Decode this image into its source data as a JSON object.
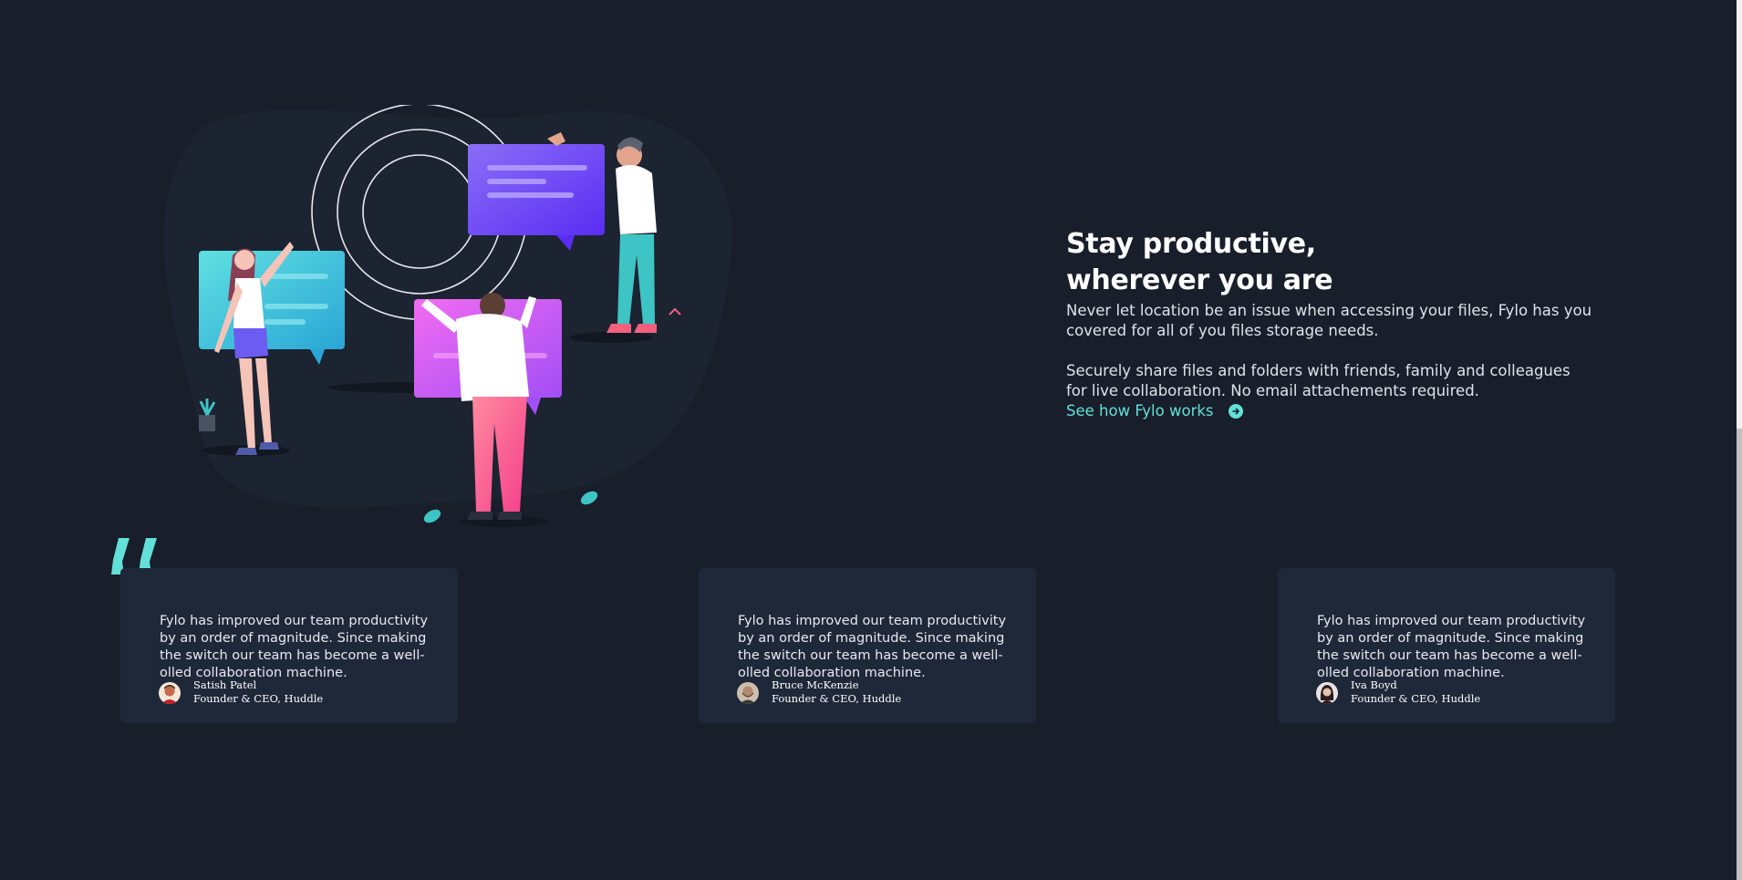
{
  "productive": {
    "title": "Stay productive, wherever you are",
    "paragraph_1": "Never let location be an issue when accessing your files, Fylo has you covered for all of you files storage needs.",
    "paragraph_2": "Securely share files and folders with friends, family and colleagues for live collaboration. No email attachements required.",
    "link_label": "See how Fylo works",
    "link_icon": "arrow-circle-icon"
  },
  "testimonials": [
    {
      "text": "Fylo has improved our team productivity by an order of magnitude. Since making the switch our team has become a well-olled collaboration machine.",
      "name": "Satish Patel",
      "role": "Founder & CEO, Huddle"
    },
    {
      "text": "Fylo has improved our team productivity by an order of magnitude. Since making the switch our team has become a well-olled collaboration machine.",
      "name": "Bruce McKenzie",
      "role": "Founder & CEO, Huddle"
    },
    {
      "text": "Fylo has improved our team productivity by an order of magnitude. Since making the switch our team has become a well-olled collaboration machine.",
      "name": "Iva Boyd",
      "role": "Founder & CEO, Huddle"
    }
  ],
  "colors": {
    "background": "#181e2a",
    "card": "#1f2839",
    "accent": "#62e0d9"
  }
}
